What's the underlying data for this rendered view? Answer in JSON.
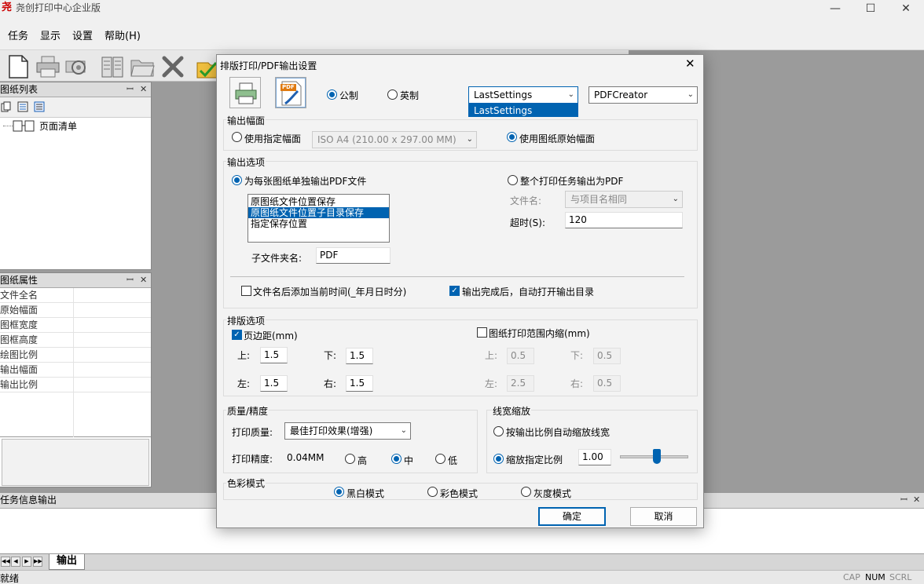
{
  "app": {
    "title": "尧创打印中心企业版",
    "logo": "尧",
    "minimize": "—",
    "maximize": "☐",
    "close": "✕"
  },
  "menu": [
    "任务",
    "显示",
    "设置",
    "帮助(H)"
  ],
  "left": {
    "drawing_list": {
      "title": "图纸列表",
      "pin": "ꟷ",
      "close": "✕",
      "tree_item": "页面清单"
    },
    "drawing_props": {
      "title": "图纸属性",
      "pin": "ꟷ",
      "close": "✕",
      "rows": [
        "文件全名",
        "原始幅面",
        "图框宽度",
        "图框高度",
        "绘图比例",
        "输出幅面",
        "输出比例"
      ]
    }
  },
  "bottom": {
    "title": "任务信息输出",
    "pin": "ꟷ",
    "close": "✕",
    "tab": "输出",
    "nav": [
      "◀◀",
      "◀",
      "▶",
      "▶▶"
    ]
  },
  "status": {
    "text": "就绪",
    "caps": "CAP",
    "num": "NUM",
    "scrl": "SCRL"
  },
  "dialog": {
    "title": "排版打印/PDF输出设置",
    "close": "✕",
    "pdf_icon_text": "PDF",
    "units": {
      "metric": "公制",
      "imperial": "英制",
      "selected": "metric"
    },
    "settings_combo": {
      "value": "LastSettings",
      "open_option": "LastSettings"
    },
    "printer_combo": {
      "value": "PDFCreator"
    },
    "paper": {
      "title": "输出幅面",
      "specify_label": "使用指定幅面",
      "specify_value": "ISO A4 (210.00 x 297.00 MM)",
      "original_label": "使用图纸原始幅面"
    },
    "output": {
      "title": "输出选项",
      "per_file_label": "为每张图纸单独输出PDF文件",
      "list_items": [
        "原图纸文件位置保存",
        "原图纸文件位置子目录保存",
        "指定保存位置"
      ],
      "list_selected": 1,
      "subfolder_label": "子文件夹名:",
      "subfolder_value": "PDF",
      "whole_task_label": "整个打印任务输出为PDF",
      "filename_label": "文件名:",
      "filename_value": "与项目名相同",
      "timeout_label": "超时(S):",
      "timeout_value": "120",
      "append_time_label": "文件名后添加当前时间(_年月日时分)",
      "open_dir_label": "输出完成后，自动打开输出目录"
    },
    "layout": {
      "title": "排版选项",
      "margin_label": "页边距(mm)",
      "top": "上:",
      "bottom": "下:",
      "left": "左:",
      "right": "右:",
      "margin_values": {
        "top": "1.5",
        "bottom": "1.5",
        "left": "1.5",
        "right": "1.5"
      },
      "shrink_label": "图纸打印范围内缩(mm)",
      "shrink_values": {
        "top": "0.5",
        "bottom": "0.5",
        "left": "2.5",
        "right": "0.5"
      }
    },
    "quality": {
      "title": "质量/精度",
      "print_quality_label": "打印质量:",
      "print_quality_value": "最佳打印效果(增强)",
      "precision_label": "打印精度:",
      "precision_value": "0.04MM",
      "high": "高",
      "mid": "中",
      "low": "低"
    },
    "linewidth": {
      "title": "线宽缩放",
      "auto_label": "按输出比例自动缩放线宽",
      "specified_label": "缩放指定比例",
      "value": "1.00",
      "slider_level": 0.55
    },
    "color": {
      "title": "色彩模式",
      "bw": "黑白模式",
      "color": "彩色模式",
      "gray": "灰度模式"
    },
    "ok": "确定",
    "cancel": "取消"
  }
}
